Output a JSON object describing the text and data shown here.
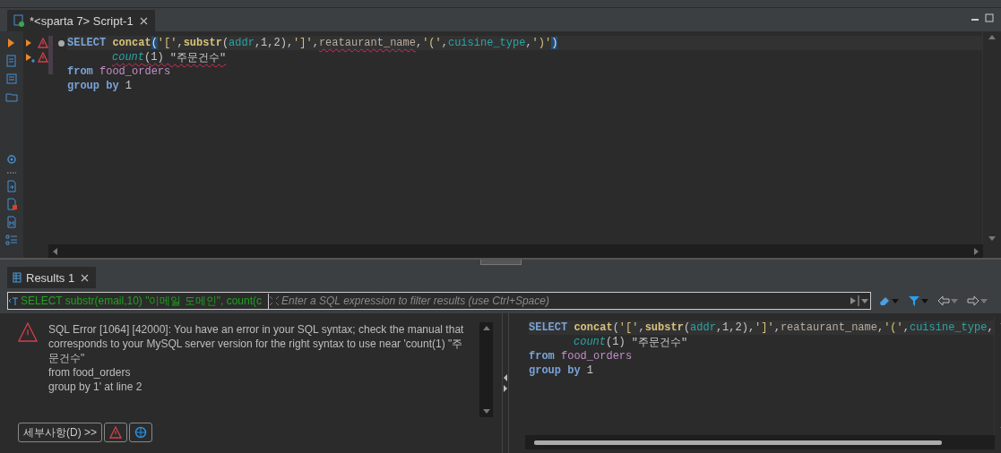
{
  "editor_tab": {
    "title": "*<sparta 7> Script-1"
  },
  "editor": {
    "lines": [
      {
        "runnable": true,
        "added": false,
        "warning": true,
        "foldable": true,
        "indented": false,
        "tokens": [
          {
            "kind": "keyword",
            "text": "SELECT "
          },
          {
            "kind": "function",
            "text": "concat"
          },
          {
            "kind": "bracket",
            "text": "("
          },
          {
            "kind": "string",
            "text": "'['"
          },
          {
            "kind": "plain",
            "text": ","
          },
          {
            "kind": "function",
            "text": "substr"
          },
          {
            "kind": "plain",
            "text": "("
          },
          {
            "kind": "column",
            "text": "addr"
          },
          {
            "kind": "plain",
            "text": ",1,2),"
          },
          {
            "kind": "string",
            "text": "']'"
          },
          {
            "kind": "plain",
            "text": ","
          },
          {
            "kind": "ident",
            "text": "reataurant_name",
            "error": true
          },
          {
            "kind": "plain",
            "text": ","
          },
          {
            "kind": "string",
            "text": "'('"
          },
          {
            "kind": "plain",
            "text": ","
          },
          {
            "kind": "column",
            "text": "cuisine_type"
          },
          {
            "kind": "plain",
            "text": ","
          },
          {
            "kind": "string",
            "text": "')'"
          },
          {
            "kind": "bracket",
            "text": ")"
          }
        ]
      },
      {
        "runnable": true,
        "added": true,
        "warning": true,
        "foldable": false,
        "indented": true,
        "tokens": [
          {
            "kind": "aggregate",
            "text": "count",
            "error": true
          },
          {
            "kind": "plain",
            "text": "(1) ",
            "error": true
          },
          {
            "kind": "plain",
            "text": "\"주문건수\"",
            "error": true
          }
        ]
      },
      {
        "runnable": false,
        "added": false,
        "warning": false,
        "foldable": false,
        "indented": false,
        "tokens": [
          {
            "kind": "keyword",
            "text": "from "
          },
          {
            "kind": "table",
            "text": "food_orders"
          }
        ]
      },
      {
        "runnable": false,
        "added": false,
        "warning": false,
        "foldable": false,
        "indented": false,
        "tokens": [
          {
            "kind": "keyword",
            "text": "group by "
          },
          {
            "kind": "plain",
            "text": "1"
          }
        ]
      }
    ]
  },
  "results_tab": {
    "label": "Results 1"
  },
  "filter": {
    "value": "SELECT substr(email,10) \"이메일 도메인\", count(c",
    "placeholder": "Enter a SQL expression to filter results (use Ctrl+Space)"
  },
  "error": {
    "message": "SQL Error [1064] [42000]: You have an error in your SQL syntax; check the manual that corresponds to your MySQL server version for the right syntax to use near 'count(1) \"주문건수\"",
    "lines": [
      "from food_orders",
      "group by 1' at line 2"
    ],
    "details_button": "세부사항(D) >>"
  },
  "preview": {
    "lines": [
      {
        "indented": false,
        "tokens": [
          {
            "kind": "keyword",
            "text": "SELECT "
          },
          {
            "kind": "function",
            "text": "concat"
          },
          {
            "kind": "plain",
            "text": "("
          },
          {
            "kind": "string",
            "text": "'['"
          },
          {
            "kind": "plain",
            "text": ","
          },
          {
            "kind": "function",
            "text": "substr"
          },
          {
            "kind": "plain",
            "text": "("
          },
          {
            "kind": "column",
            "text": "addr"
          },
          {
            "kind": "plain",
            "text": ",1,2),"
          },
          {
            "kind": "string",
            "text": "']'"
          },
          {
            "kind": "plain",
            "text": ","
          },
          {
            "kind": "ident",
            "text": "reataurant_name"
          },
          {
            "kind": "plain",
            "text": ","
          },
          {
            "kind": "string",
            "text": "'('"
          },
          {
            "kind": "plain",
            "text": ","
          },
          {
            "kind": "column",
            "text": "cuisine_type"
          },
          {
            "kind": "plain",
            "text": ","
          }
        ]
      },
      {
        "indented": true,
        "tokens": [
          {
            "kind": "aggregate",
            "text": "count"
          },
          {
            "kind": "plain",
            "text": "(1) "
          },
          {
            "kind": "plain",
            "text": "\"주문건수\""
          }
        ]
      },
      {
        "indented": false,
        "tokens": [
          {
            "kind": "keyword",
            "text": "from "
          },
          {
            "kind": "table",
            "text": "food_orders"
          }
        ]
      },
      {
        "indented": false,
        "tokens": [
          {
            "kind": "keyword",
            "text": "group by "
          },
          {
            "kind": "plain",
            "text": "1"
          }
        ]
      }
    ]
  }
}
